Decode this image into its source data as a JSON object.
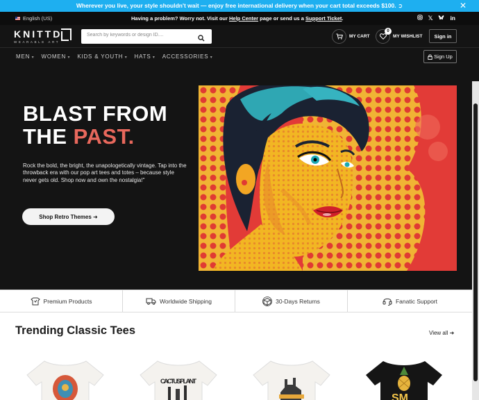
{
  "promo": {
    "text": "Wherever you live, your style shouldn't wait — enjoy free international delivery when your cart total exceeds $100. ➲"
  },
  "util": {
    "language": "English (US)",
    "help_prefix": "Having a problem? Worry not. Visit our ",
    "help_center": "Help Center",
    "help_middle": " page or send us a ",
    "support_ticket": "Support Ticket",
    "help_suffix": "."
  },
  "header": {
    "logo_word": "KNITTD",
    "logo_sub": "WEARABLE ART",
    "search_placeholder": "Search by keywords or design ID....",
    "cart_label": "MY CART",
    "wishlist_label": "MY WISHLIST",
    "wishlist_count": "0",
    "signin_label": "Sign in"
  },
  "nav": {
    "items": [
      {
        "label": "MEN"
      },
      {
        "label": "WOMEN"
      },
      {
        "label": "KIDS & YOUTH"
      },
      {
        "label": "HATS"
      },
      {
        "label": "ACCESSORIES"
      }
    ],
    "signup_label": "Sign Up"
  },
  "hero": {
    "title_line1": "BLAST FROM",
    "title_line2_a": "THE ",
    "title_line2_b": "PAST.",
    "body": "Rock the bold, the bright, the unapologetically vintage. Tap into the throwback era with our pop art tees and totes – because style never gets old. Shop now and own the nostalgia!\"",
    "cta_label": "Shop Retro Themes ➜"
  },
  "features": [
    {
      "label": "Premium Products",
      "icon": "premium-icon"
    },
    {
      "label": "Worldwide Shipping",
      "icon": "truck-icon"
    },
    {
      "label": "30-Days Returns",
      "icon": "return-box-icon"
    },
    {
      "label": "Fanatic Support",
      "icon": "headset-icon"
    }
  ],
  "trending": {
    "title": "Trending Classic Tees",
    "view_all": "View all ➜",
    "tee_prints": [
      "",
      "CACTUS PLANT",
      "",
      "SM"
    ]
  },
  "colors": {
    "promo_bg": "#1eaff0",
    "hero_accent": "#e8685c",
    "page_bg": "#141414"
  }
}
